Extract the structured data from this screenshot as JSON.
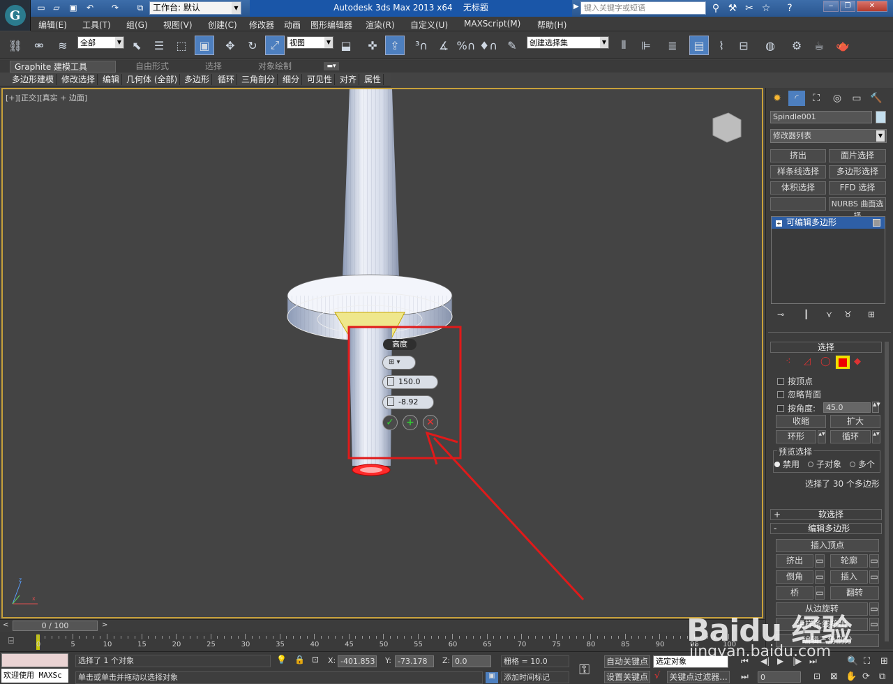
{
  "titlebar": {
    "workspace_label": "工作台: 默认",
    "app_title": "Autodesk 3ds Max  2013 x64",
    "doc_title": "无标题",
    "search_placeholder": "键入关键字或短语"
  },
  "menubar": {
    "items": [
      "编辑(E)",
      "工具(T)",
      "组(G)",
      "视图(V)",
      "创建(C)",
      "修改器",
      "动画",
      "图形编辑器",
      "渲染(R)",
      "自定义(U)",
      "MAXScript(M)",
      "帮助(H)"
    ]
  },
  "toolbar": {
    "filter_value": "全部",
    "refcoord_value": "视图",
    "selset_value": "创建选择集"
  },
  "ribbon": {
    "tabs": [
      "Graphite 建模工具",
      "自由形式",
      "选择",
      "对象绘制"
    ],
    "subtabs": [
      "多边形建模",
      "修改选择",
      "编辑",
      "几何体 (全部)",
      "多边形",
      "循环",
      "三角剖分",
      "细分",
      "可见性",
      "对齐",
      "属性"
    ]
  },
  "viewport": {
    "label": "[+][正交][真实 + 边面]"
  },
  "caddy": {
    "title": "高度",
    "height_value": "150.0",
    "outline_value": "-8.92"
  },
  "cmdpanel": {
    "object_name": "Spindle001",
    "modifier_list": "修改器列表",
    "mod_buttons": [
      "挤出",
      "面片选择",
      "样条线选择",
      "多边形选择",
      "体积选择",
      "FFD 选择",
      "",
      "NURBS 曲面选择"
    ],
    "stack_item": "可编辑多边形",
    "rollout_select": "选择",
    "chk_vertex": "按顶点",
    "chk_backface": "忽略背面",
    "chk_angle": "按角度:",
    "angle_value": "45.0",
    "btn_shrink": "收缩",
    "btn_grow": "扩大",
    "btn_ring": "环形",
    "btn_loop": "循环",
    "preview_label": "预览选择",
    "radio_off": "禁用",
    "radio_sub": "子对象",
    "radio_multi": "多个",
    "selection_info": "选择了 30 个多边形",
    "rollout_soft": "软选择",
    "rollout_edit": "编辑多边形",
    "btn_insert_vertex": "插入顶点",
    "btn_extrude": "挤出",
    "btn_outline": "轮廓",
    "btn_bevel": "倒角",
    "btn_inset": "插入",
    "btn_bridge": "桥",
    "btn_flip": "翻转",
    "btn_hinge": "从边旋转",
    "btn_along_spline": "沿样条线挤出",
    "btn_edit_tri": "编辑三角剖分"
  },
  "timeline": {
    "frame_label": "0 / 100",
    "ticks": [
      "0",
      "5",
      "10",
      "15",
      "20",
      "25",
      "30",
      "35",
      "40",
      "45",
      "50",
      "55",
      "60",
      "65",
      "70",
      "75",
      "80",
      "85",
      "90",
      "95",
      "100"
    ]
  },
  "status": {
    "selected": "选择了 1 个对象",
    "prompt": "单击或单击并拖动以选择对象",
    "welcome": "欢迎使用 MAXSc",
    "x_value": "-401.853",
    "y_value": "-73.178",
    "z_value": "0.0",
    "grid": "栅格 = 10.0",
    "autokey": "自动关键点",
    "setkey": "设置关键点",
    "keyfilter": "关键点过滤器...",
    "selobj": "选定对象",
    "add_time_tag": "添加时间标记",
    "frame_value": "0",
    "x_label": "X:",
    "y_label": "Y:",
    "z_label": "Z:"
  },
  "watermark": {
    "text": "Baidu 经验",
    "sub": "jingyan.baidu.com"
  },
  "colors": {
    "accent": "#e01a1a",
    "selection": "#f0e67a",
    "title_blue": "#1a56a8"
  }
}
